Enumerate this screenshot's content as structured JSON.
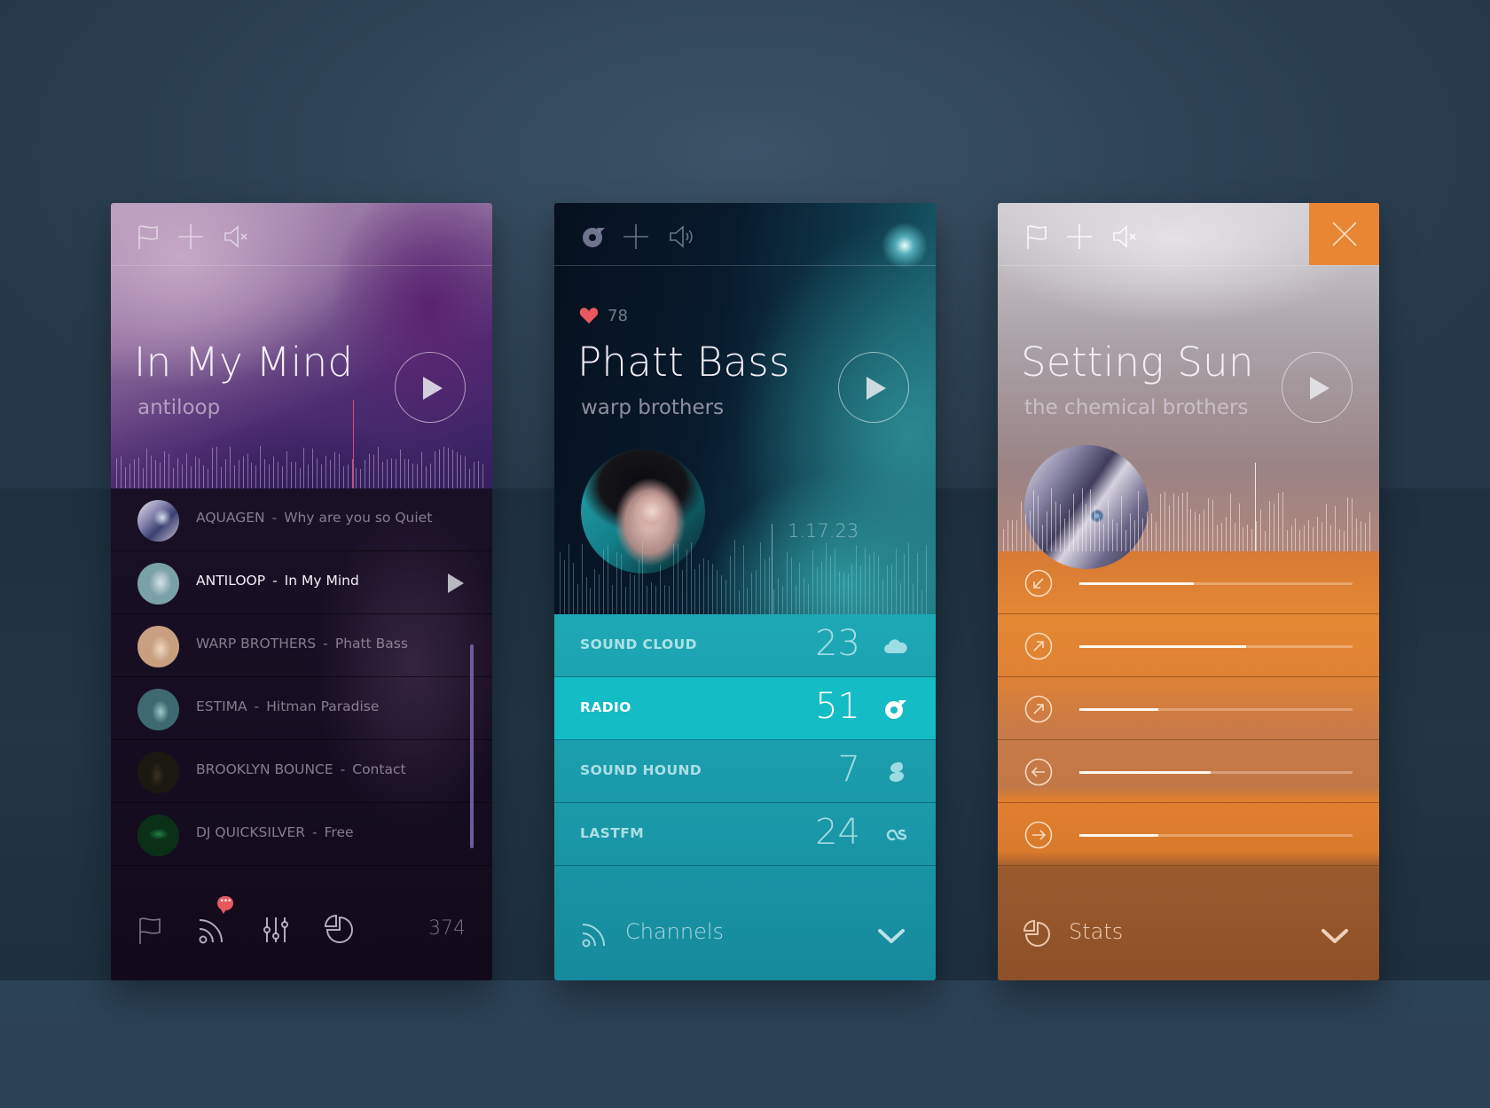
{
  "accent_colors": {
    "close_button": "#e88634",
    "radio_highlight": "#14bcc6",
    "heart": "#e8585c",
    "badge": "#e8585c",
    "scrollbar": "#6f5a9c"
  },
  "panels": [
    {
      "id": "now-playing-antiloop",
      "header_icons": [
        "flag-icon",
        "plus-icon",
        "mute-icon"
      ],
      "title": "In My Mind",
      "artist": "antiloop",
      "playlist": [
        {
          "artist": "AQUAGEN",
          "separator": "-",
          "song": "Why are you so Quiet",
          "active": false
        },
        {
          "artist": "ANTILOOP",
          "separator": "-",
          "song": "In My Mind",
          "active": true
        },
        {
          "artist": "WARP BROTHERS",
          "separator": "-",
          "song": "Phatt Bass",
          "active": false
        },
        {
          "artist": "ESTIMA",
          "separator": "-",
          "song": "Hitman Paradise",
          "active": false
        },
        {
          "artist": "BROOKLYN BOUNCE",
          "separator": "-",
          "song": "Contact",
          "active": false
        },
        {
          "artist": "DJ QUICKSILVER",
          "separator": "-",
          "song": "Free",
          "active": false
        }
      ],
      "footer": {
        "icons": [
          "flag-icon",
          "rss-icon",
          "equalizer-icon",
          "stats-icon"
        ],
        "badge_text": "•••",
        "count": "374"
      }
    },
    {
      "id": "now-playing-warp-brothers",
      "header_icons": [
        "radio-icon",
        "plus-icon",
        "volume-icon"
      ],
      "likes": "78",
      "title": "Phatt Bass",
      "artist": "warp brothers",
      "time": "1.17.23",
      "sources": [
        {
          "label": "SOUND CLOUD",
          "value": "23",
          "icon": "cloud-icon",
          "active": false
        },
        {
          "label": "RADIO",
          "value": "51",
          "icon": "radio-icon",
          "active": true
        },
        {
          "label": "SOUND HOUND",
          "value": "7",
          "icon": "soundhound-icon",
          "active": false
        },
        {
          "label": "LASTFM",
          "value": "24",
          "icon": "lastfm-icon",
          "active": false
        }
      ],
      "footer": {
        "label": "Channels",
        "icon": "rss-icon"
      }
    },
    {
      "id": "now-playing-chemical-brothers",
      "header_icons": [
        "flag-icon",
        "plus-icon",
        "mute-icon"
      ],
      "close_icon": "close-icon",
      "title": "Setting Sun",
      "artist": "the chemical brothers",
      "sliders": [
        {
          "icon": "arrow-down-left-icon",
          "value": 0.42
        },
        {
          "icon": "arrow-up-right-icon",
          "value": 0.61
        },
        {
          "icon": "arrow-up-right-icon",
          "value": 0.29
        },
        {
          "icon": "arrow-left-icon",
          "value": 0.48
        },
        {
          "icon": "arrow-right-icon",
          "value": 0.29
        }
      ],
      "footer": {
        "label": "Stats",
        "icon": "stats-icon"
      }
    }
  ]
}
